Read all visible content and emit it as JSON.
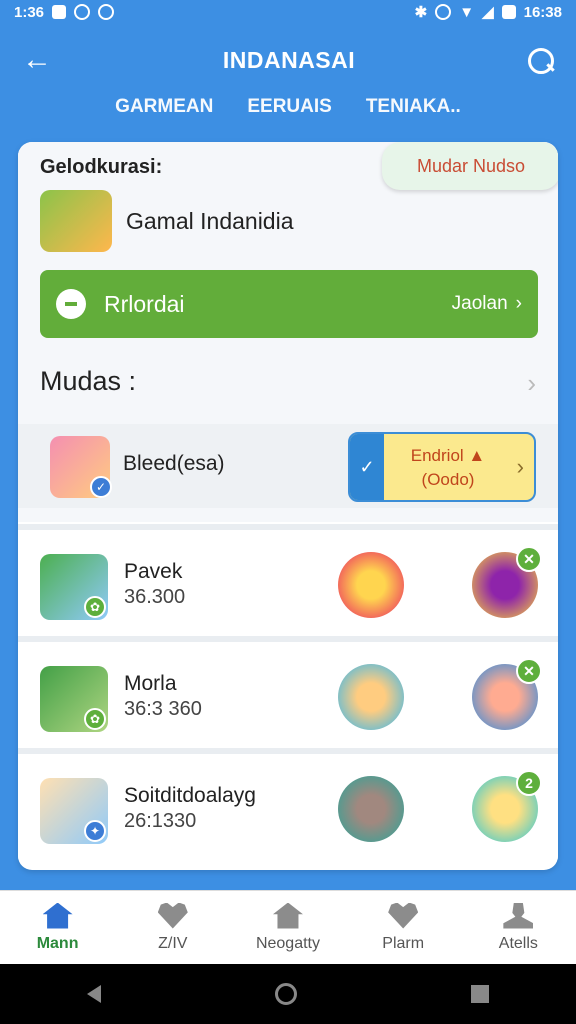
{
  "status": {
    "time_left": "1:36",
    "time_right": "16:38"
  },
  "appbar": {
    "title": "INDANASAI"
  },
  "tabs": [
    "GARMEAN",
    "EERUAIS",
    "TENIAKA.."
  ],
  "card": {
    "choose_label": "Gelodkurasi:",
    "manage_button": "Mudar Nudso",
    "game_name": "Gamal Indanidia",
    "green_bar": {
      "label": "Rrlordai",
      "action": "Jaolan"
    },
    "section_title": "Mudas :",
    "first_item": {
      "name": "Bleed(esa)",
      "action_line1": "Endriol ▲",
      "action_line2": "(Oodo)"
    },
    "items": [
      {
        "name": "Pavek",
        "score": "36.300",
        "badge": "✕"
      },
      {
        "name": "Morla",
        "score": "36:3 360",
        "badge": "✕"
      },
      {
        "name": "Soitditdoalayg",
        "score": "26:1330",
        "badge": "2"
      }
    ]
  },
  "bottom_nav": [
    {
      "label": "Mann",
      "icon": "home-icon",
      "active": true
    },
    {
      "label": "Z/IV",
      "icon": "heart-icon",
      "active": false
    },
    {
      "label": "Neogatty",
      "icon": "house-icon",
      "active": false
    },
    {
      "label": "Plarm",
      "icon": "heart-icon",
      "active": false
    },
    {
      "label": "Atells",
      "icon": "user-icon",
      "active": false
    }
  ],
  "colors": {
    "primary": "#3d8fe3",
    "green": "#62ad3a",
    "accent": "#c94c34"
  }
}
